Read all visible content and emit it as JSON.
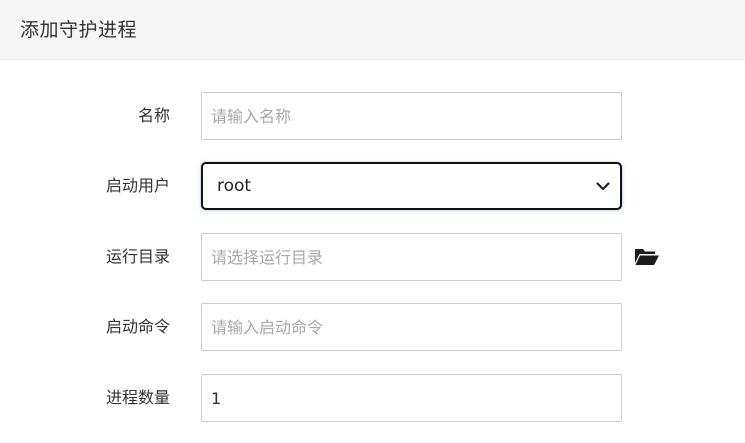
{
  "dialog": {
    "title": "添加守护进程"
  },
  "form": {
    "name": {
      "label": "名称",
      "placeholder": "请输入名称",
      "value": ""
    },
    "user": {
      "label": "启动用户",
      "selected": "root"
    },
    "directory": {
      "label": "运行目录",
      "placeholder": "请选择运行目录",
      "value": "",
      "browse_icon": "folder-open-icon"
    },
    "command": {
      "label": "启动命令",
      "placeholder": "请输入启动命令",
      "value": ""
    },
    "process_count": {
      "label": "进程数量",
      "value": "1"
    }
  }
}
